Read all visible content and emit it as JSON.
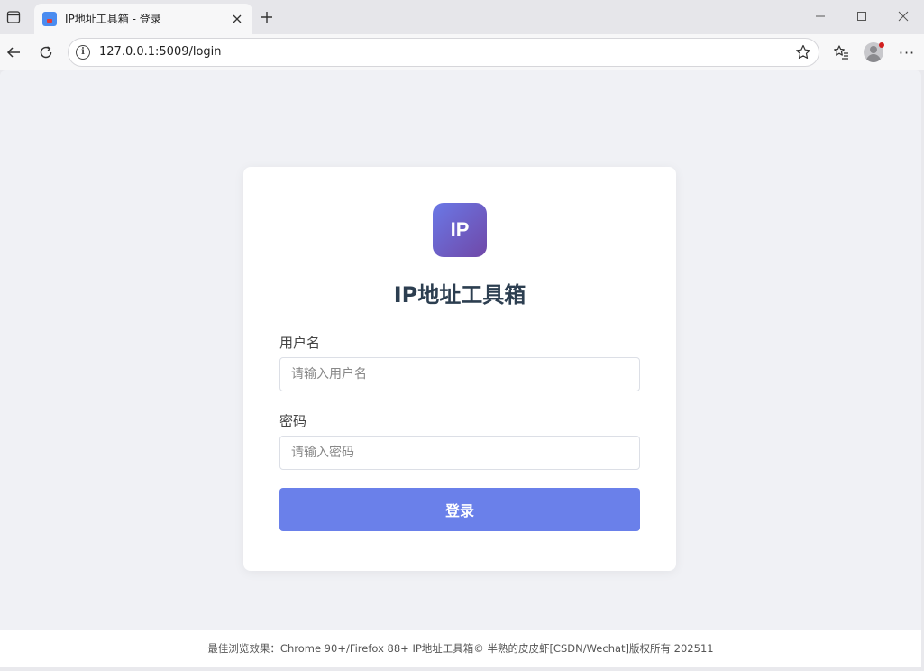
{
  "browser": {
    "tab": {
      "title": "IP地址工具箱 - 登录"
    },
    "url": "127.0.0.1:5009/login"
  },
  "app": {
    "logo_text": "IP",
    "title": "IP地址工具箱",
    "accent_color": "#6a80ea"
  },
  "form": {
    "username": {
      "label": "用户名",
      "placeholder": "请输入用户名",
      "value": ""
    },
    "password": {
      "label": "密码",
      "placeholder": "请输入密码",
      "value": ""
    },
    "submit_label": "登录"
  },
  "footer": {
    "text": "最佳浏览效果：Chrome 90+/Firefox 88+ IP地址工具箱© 半熟的皮皮虾[CSDN/Wechat]版权所有 202511"
  }
}
